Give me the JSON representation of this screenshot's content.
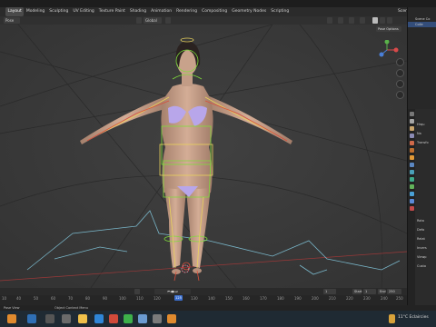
{
  "menu": {
    "tabs": [
      "Layout",
      "Modeling",
      "Sculpting",
      "UV Editing",
      "Texture Paint",
      "Shading",
      "Animation",
      "Rendering",
      "Compositing",
      "Geometry Nodes",
      "Scripting"
    ],
    "active_tab": "Layout",
    "scene": "Scene"
  },
  "header": {
    "mode": "Pose",
    "orientation": "Global"
  },
  "viewport": {
    "pose_options": "Pose Options"
  },
  "outliner": {
    "rows": [
      "Scene Co",
      "Colle",
      "",
      "",
      "",
      "",
      "",
      "",
      "",
      "",
      "",
      ""
    ]
  },
  "properties": {
    "lines": [
      "Hrqu",
      "Na",
      "Transfo",
      "",
      "",
      "",
      "",
      "",
      "",
      "",
      "Rota",
      "Defo",
      "Relat",
      "Invers",
      "Viewp",
      "Custo"
    ]
  },
  "timeline": {
    "ticks": [
      "10",
      "40",
      "50",
      "60",
      "70",
      "80",
      "90",
      "100",
      "110",
      "120",
      "130",
      "140",
      "150",
      "160",
      "170",
      "180",
      "190",
      "200",
      "210",
      "220",
      "230",
      "240",
      "250"
    ],
    "current_frame": "125",
    "frame_field": "1",
    "start_label": "Start",
    "start_value": "1",
    "end_label": "End",
    "end_value": "250"
  },
  "status": {
    "left": "Pose View",
    "middle": "Object Context Menu"
  },
  "taskbar": {
    "weather": "11°C  Eclaircies"
  },
  "colors": {
    "accent": "#3b6fcf",
    "bone_green": "#7fdc3a",
    "bone_yellow": "#e9d25c",
    "bone_red": "#d8503c",
    "bone_cyan": "#79b6c9"
  }
}
